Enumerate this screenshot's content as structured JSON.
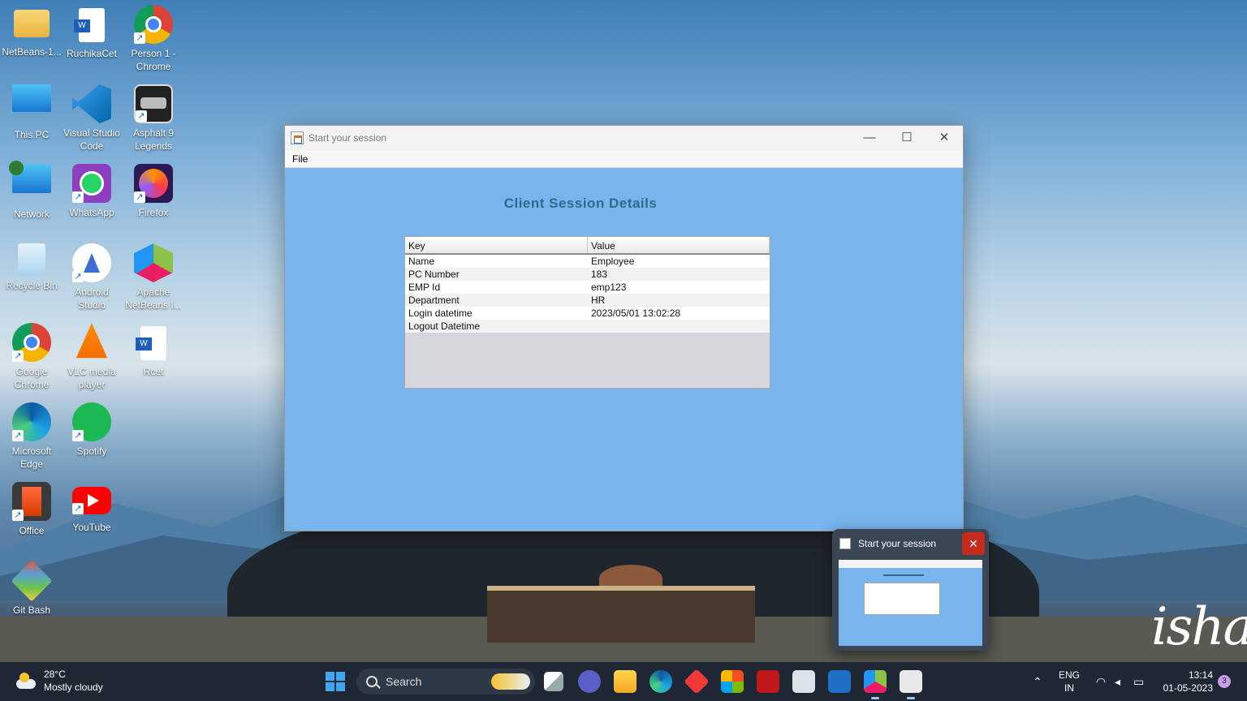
{
  "desktop": {
    "icons": [
      {
        "label": "NetBeans-1...",
        "icon": "folder-icon"
      },
      {
        "label": "RuchikaCet",
        "icon": "word-doc-icon"
      },
      {
        "label": "Person 1 - Chrome",
        "icon": "chrome-icon"
      },
      {
        "label": "This PC",
        "icon": "monitor-icon"
      },
      {
        "label": "Visual Studio Code",
        "icon": "vscode-icon"
      },
      {
        "label": "Asphalt 9 Legends",
        "icon": "game-icon"
      },
      {
        "label": "Network",
        "icon": "network-icon"
      },
      {
        "label": "WhatsApp",
        "icon": "whatsapp-icon"
      },
      {
        "label": "Firefox",
        "icon": "firefox-icon"
      },
      {
        "label": "Recycle Bin",
        "icon": "recycle-bin-icon"
      },
      {
        "label": "Android Studio",
        "icon": "android-studio-icon"
      },
      {
        "label": "Apache NetBeans I...",
        "icon": "netbeans-icon"
      },
      {
        "label": "Google Chrome",
        "icon": "chrome-icon"
      },
      {
        "label": "VLC media player",
        "icon": "vlc-icon"
      },
      {
        "label": "Rcet",
        "icon": "word-doc-icon"
      },
      {
        "label": "Microsoft Edge",
        "icon": "edge-icon"
      },
      {
        "label": "Spotify",
        "icon": "spotify-icon"
      },
      {
        "label": "Office",
        "icon": "office-icon"
      },
      {
        "label": "YouTube",
        "icon": "youtube-icon"
      },
      {
        "label": "Git Bash",
        "icon": "git-icon"
      }
    ],
    "wallpaper_logo": "isha"
  },
  "window": {
    "title": "Start your session",
    "menu": {
      "file": "File"
    },
    "heading": "Client Session Details",
    "table": {
      "headers": {
        "key": "Key",
        "value": "Value"
      },
      "rows": [
        {
          "key": "Name",
          "value": "Employee"
        },
        {
          "key": "PC Number",
          "value": "183"
        },
        {
          "key": "EMP Id",
          "value": "emp123"
        },
        {
          "key": "Department",
          "value": "HR"
        },
        {
          "key": "Login datetime",
          "value": "2023/05/01 13:02:28"
        },
        {
          "key": "Logout Datetime",
          "value": ""
        }
      ]
    }
  },
  "preview": {
    "title": "Start your session"
  },
  "taskbar": {
    "weather": {
      "temp": "28°C",
      "condition": "Mostly cloudy"
    },
    "search_label": "Search",
    "language": {
      "line1": "ENG",
      "line2": "IN"
    },
    "clock": {
      "time": "13:14",
      "date": "01-05-2023"
    },
    "notification_count": "3"
  },
  "colors": {
    "client_bg": "#79b4ed",
    "heading": "#2b6b8c",
    "taskbar_bg": "#1e2733",
    "close_red": "#c42b1c"
  }
}
